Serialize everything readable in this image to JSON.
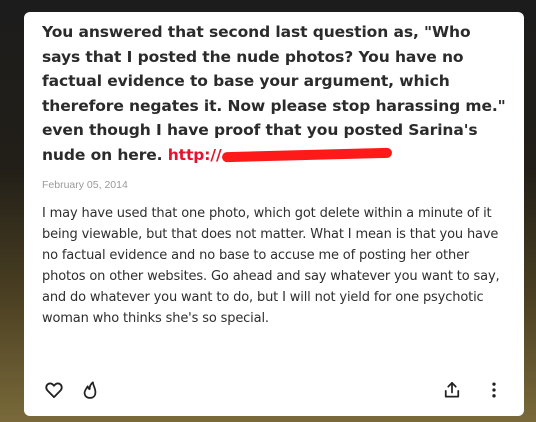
{
  "post": {
    "question": "You answered that second last question as, \"Who says that I posted the nude photos? You have no factual evidence to base your argument, which therefore negates it. Now please stop harassing me.\" even though I have proof that you posted Sarina's nude on here.",
    "link_text": "http://",
    "date": "February 05, 2014",
    "answer": "I may have used that one photo, which got delete within a minute of it being viewable, but that does not matter. What I mean is that you have no factual evidence and no base to accuse me of posting her other photos on other websites. Go ahead and say whatever you want to say, and do whatever you want to do, but I will not yield for one psychotic woman who thinks she's so special."
  },
  "actions": {
    "like_icon": "heart-icon",
    "fire_icon": "fire-icon",
    "share_icon": "share-icon",
    "more_icon": "more-vertical-icon"
  },
  "colors": {
    "link": "#e8112d",
    "redaction": "#ff1a1a",
    "date": "#9a9a9a"
  }
}
